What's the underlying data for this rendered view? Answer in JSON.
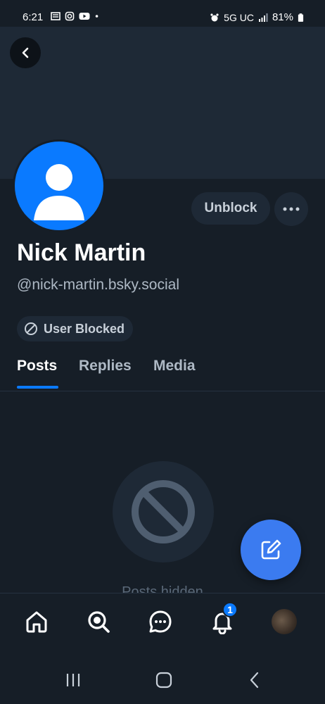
{
  "status_bar": {
    "time": "6:21",
    "network": "5G UC",
    "battery": "81%"
  },
  "profile": {
    "display_name": "Nick Martin",
    "handle": "@nick-martin.bsky.social",
    "unblock_label": "Unblock",
    "blocked_label": "User Blocked",
    "avatar_color": "#0a7aff"
  },
  "tabs": [
    {
      "label": "Posts",
      "active": true
    },
    {
      "label": "Replies",
      "active": false
    },
    {
      "label": "Media",
      "active": false
    }
  ],
  "empty_state": {
    "text": "Posts hidden"
  },
  "bottom_nav": {
    "notifications_badge": "1",
    "items": [
      "home-icon",
      "search-icon",
      "chat-icon",
      "bell-icon",
      "profile-avatar"
    ]
  },
  "colors": {
    "background": "#161e27",
    "surface": "#1e2936",
    "accent": "#0a7aff",
    "fab": "#3b7bf0"
  }
}
